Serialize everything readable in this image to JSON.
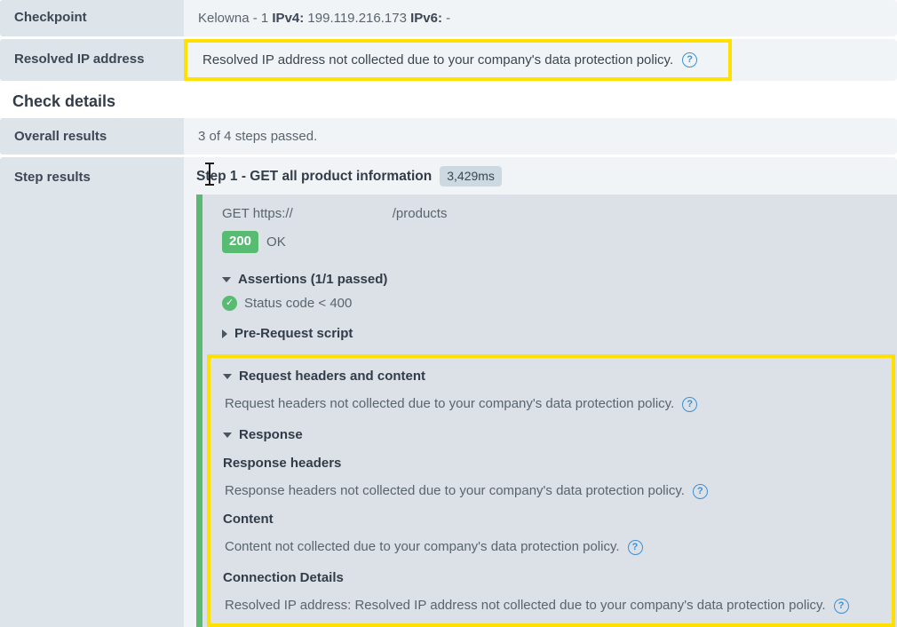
{
  "summary_rows": [
    {
      "label": "Checkpoint",
      "value_prefix": "Kelowna - 1 ",
      "ipv4_label": "IPv4:",
      "ipv4_value": " 199.119.216.173 ",
      "ipv6_label": "IPv6:",
      "ipv6_value": " -"
    },
    {
      "label": "Resolved IP address",
      "value": "Resolved IP address not collected due to your company's data protection policy.",
      "help_icon": "help-circle-icon",
      "highlighted": true
    }
  ],
  "section": {
    "heading": "Check details",
    "overall": {
      "label": "Overall results",
      "value": "3 of 4 steps passed."
    },
    "step_results": {
      "label": "Step results"
    }
  },
  "step": {
    "title": "Step 1 - GET all product information",
    "duration_badge": "3,429ms",
    "request": {
      "method_and_host": "GET https://",
      "redacted_host": "",
      "path": "/products"
    },
    "status": {
      "code": "200",
      "text": "OK",
      "code_color": "#57bb72"
    },
    "assertions": {
      "heading": "Assertions (1/1 passed)",
      "caret": "caret-down-icon",
      "items": [
        {
          "icon": "check-circle-icon",
          "text": "Status code < 400"
        }
      ]
    },
    "pre_request": {
      "heading": "Pre-Request script",
      "caret": "caret-right-icon"
    },
    "request_headers": {
      "heading": "Request headers and content",
      "caret": "caret-down-icon",
      "text": "Request headers not collected due to your company's data protection policy.",
      "help_icon": "help-circle-icon"
    },
    "response": {
      "heading": "Response",
      "caret": "caret-down-icon",
      "headers_label": "Response headers",
      "headers_text": "Response headers not collected due to your company's data protection policy.",
      "headers_help_icon": "help-circle-icon",
      "content_label": "Content",
      "content_text": "Content not collected due to your company's data protection policy.",
      "content_help_icon": "help-circle-icon"
    },
    "connection_details": {
      "heading": "Connection Details",
      "text": "Resolved IP address: Resolved IP address not collected due to your company's data protection policy.",
      "help_icon": "help-circle-icon"
    }
  },
  "colors": {
    "highlight_yellow": "#ffe000",
    "green_bar": "#5cb974",
    "status_green": "#57bb72",
    "label_bg": "#dde5ea",
    "value_bg": "#f1f4f7",
    "panel_bg": "#dbe1e6",
    "help_blue": "#3f8fd0"
  }
}
